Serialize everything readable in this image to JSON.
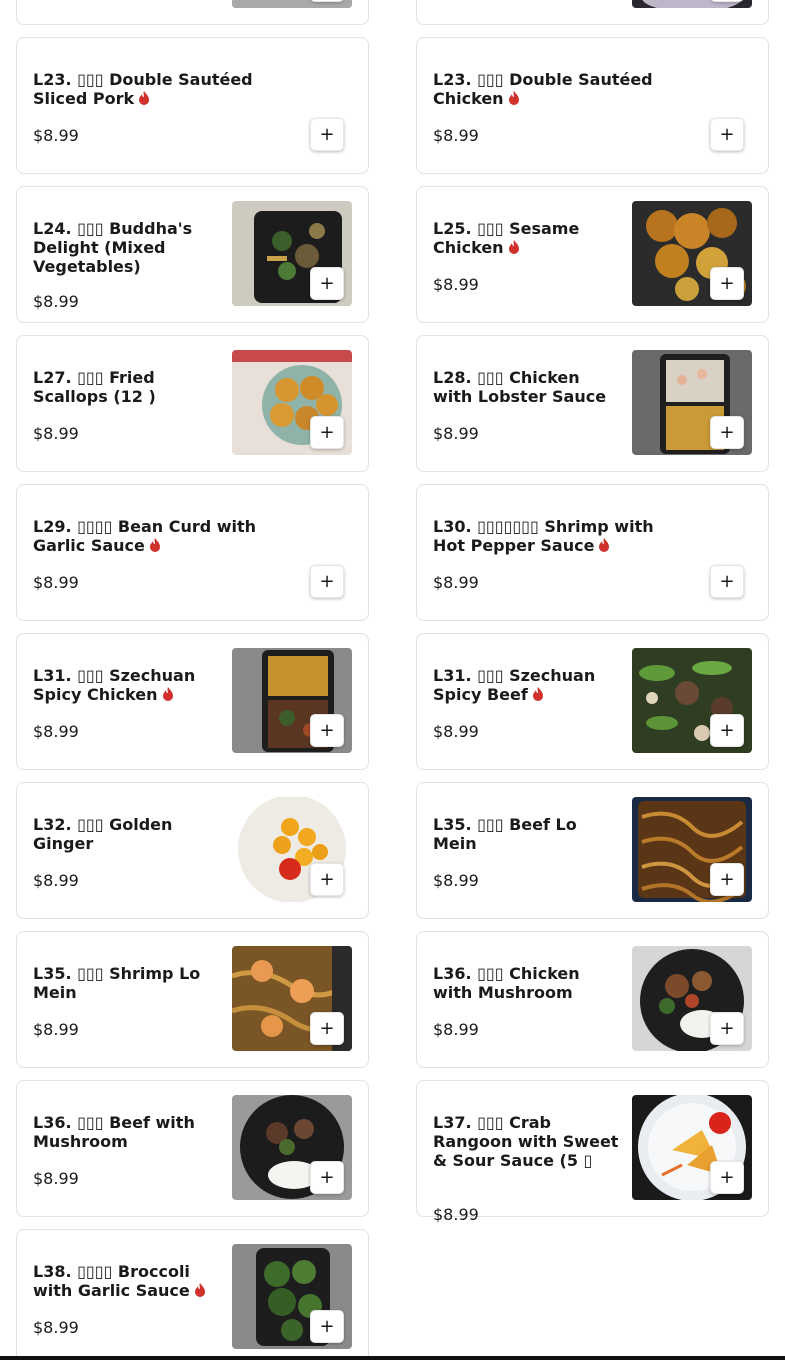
{
  "currency_symbol": "$",
  "add_label": "+",
  "items": [
    {
      "id": "prev-a",
      "name": "",
      "price": "",
      "spicy": false,
      "image": "food-photo",
      "hidden_top": true
    },
    {
      "id": "prev-b",
      "name": "",
      "price": "",
      "spicy": false,
      "image": "food-photo",
      "hidden_top": true
    },
    {
      "id": "L23-pork",
      "name": "L23. ▯▯▯ Double Sautéed Sliced Pork",
      "price": "$8.99",
      "spicy": true,
      "image": null
    },
    {
      "id": "L23-chicken",
      "name": "L23. ▯▯▯ Double Sautéed Chicken",
      "price": "$8.99",
      "spicy": true,
      "image": null
    },
    {
      "id": "L24",
      "name": "L24. ▯▯▯ Buddha's Delight (Mixed Vegetables)",
      "price": "$8.99",
      "spicy": false,
      "image": "mixed-vegetables-photo"
    },
    {
      "id": "L25",
      "name": "L25. ▯▯▯ Sesame Chicken",
      "price": "$8.99",
      "spicy": true,
      "image": "sesame-chicken-photo"
    },
    {
      "id": "L27",
      "name": "L27. ▯▯▯ Fried Scallops (12 )",
      "price": "$8.99",
      "spicy": false,
      "image": "fried-scallops-photo"
    },
    {
      "id": "L28",
      "name": "L28. ▯▯▯ Chicken with Lobster Sauce",
      "price": "$8.99",
      "spicy": false,
      "image": "lobster-sauce-photo"
    },
    {
      "id": "L29",
      "name": "L29. ▯▯▯▯ Bean Curd with Garlic Sauce",
      "price": "$8.99",
      "spicy": true,
      "image": null
    },
    {
      "id": "L30",
      "name": "L30. ▯▯▯▯▯▯▯ Shrimp with Hot Pepper Sauce",
      "price": "$8.99",
      "spicy": true,
      "image": null
    },
    {
      "id": "L31-chicken",
      "name": "L31. ▯▯▯ Szechuan Spicy Chicken",
      "price": "$8.99",
      "spicy": true,
      "image": "szechuan-chicken-photo"
    },
    {
      "id": "L31-beef",
      "name": "L31. ▯▯▯ Szechuan Spicy Beef",
      "price": "$8.99",
      "spicy": true,
      "image": "szechuan-beef-photo"
    },
    {
      "id": "L32",
      "name": "L32. ▯▯▯ Golden Ginger",
      "price": "$8.99",
      "spicy": false,
      "image": "golden-ginger-photo"
    },
    {
      "id": "L35-beef",
      "name": "L35. ▯▯▯ Beef Lo Mein",
      "price": "$8.99",
      "spicy": false,
      "image": "beef-lo-mein-photo"
    },
    {
      "id": "L35-shrimp",
      "name": "L35. ▯▯▯ Shrimp Lo Mein",
      "price": "$8.99",
      "spicy": false,
      "image": "shrimp-lo-mein-photo"
    },
    {
      "id": "L36-chicken",
      "name": "L36. ▯▯▯ Chicken with Mushroom",
      "price": "$8.99",
      "spicy": false,
      "image": "chicken-mushroom-photo"
    },
    {
      "id": "L36-beef",
      "name": "L36. ▯▯▯ Beef with Mushroom",
      "price": "$8.99",
      "spicy": false,
      "image": "beef-mushroom-photo"
    },
    {
      "id": "L37",
      "name": "L37. ▯▯▯ Crab Rangoon with Sweet & Sour Sauce (5 ▯",
      "price": "$8.99",
      "spicy": false,
      "image": "crab-rangoon-photo"
    },
    {
      "id": "L38",
      "name": "L38. ▯▯▯▯ Broccoli with Garlic Sauce",
      "price": "$8.99",
      "spicy": true,
      "image": "broccoli-photo"
    }
  ],
  "colors": {
    "spicy_icon": "#d0312d",
    "card_border": "#e2e2e2",
    "text": "#1a1a1a"
  }
}
